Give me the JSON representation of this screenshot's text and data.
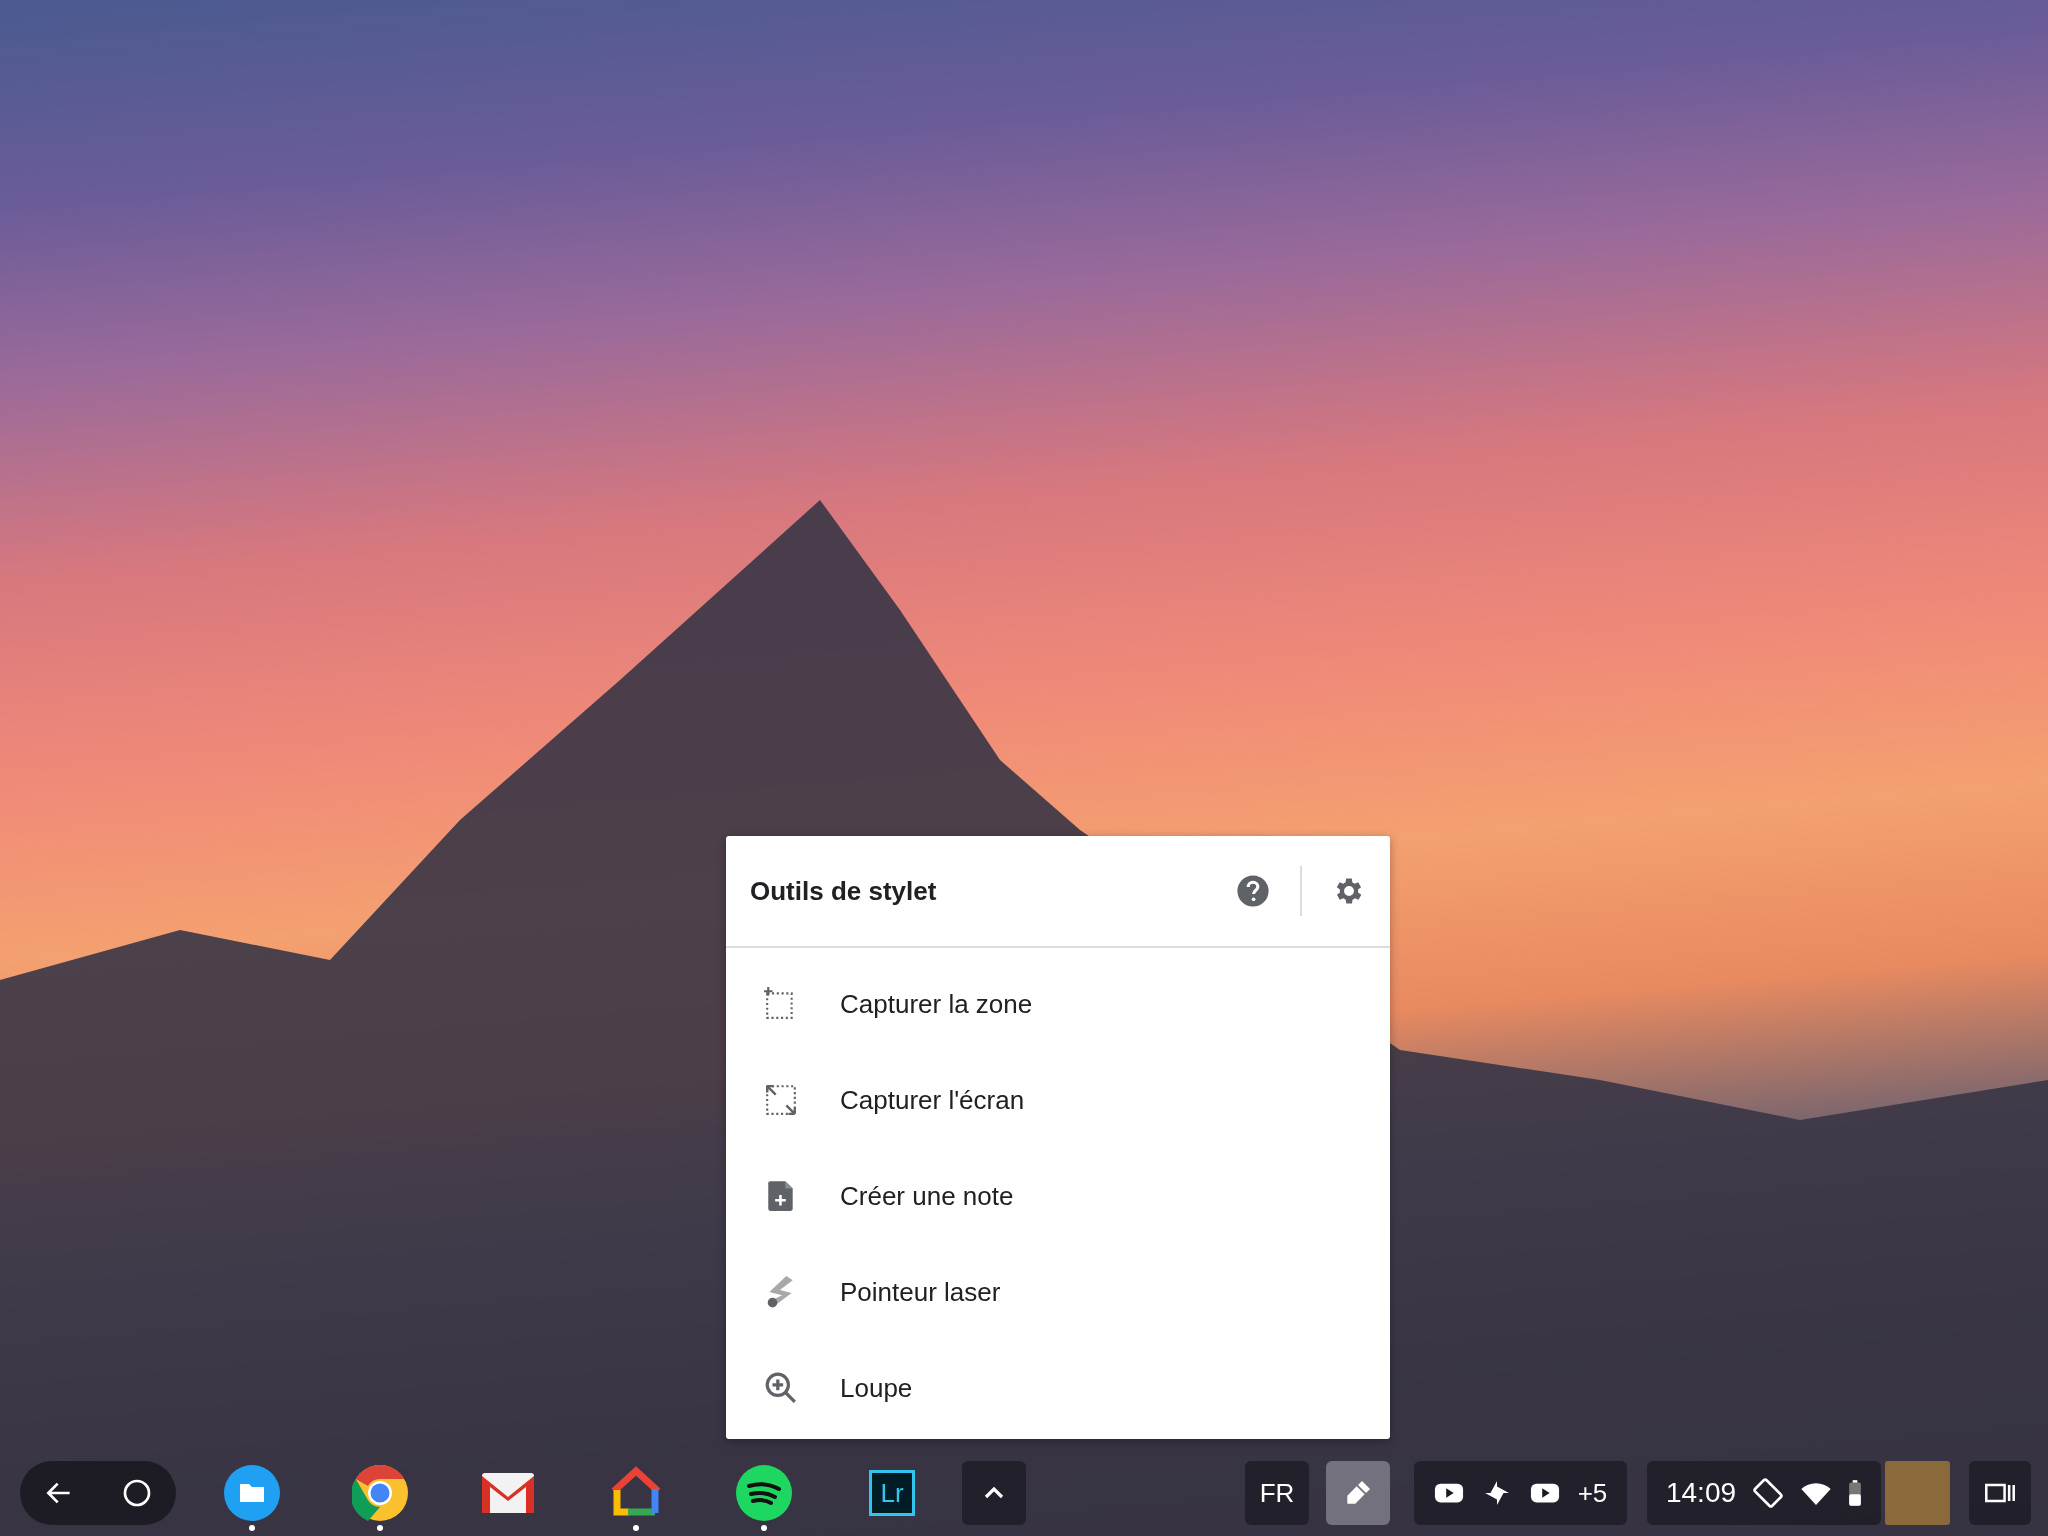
{
  "menu": {
    "title": "Outils de stylet",
    "items": [
      {
        "kind": "region",
        "label": "Capturer la zone"
      },
      {
        "kind": "screen",
        "label": "Capturer l'écran"
      },
      {
        "kind": "note",
        "label": "Créer une note"
      },
      {
        "kind": "laser",
        "label": "Pointeur laser"
      },
      {
        "kind": "magnifier",
        "label": "Loupe"
      }
    ]
  },
  "shelf": {
    "apps": [
      {
        "kind": "files",
        "running": true
      },
      {
        "kind": "chrome",
        "running": true
      },
      {
        "kind": "gmail",
        "running": false
      },
      {
        "kind": "home",
        "running": true
      },
      {
        "kind": "spotify",
        "running": true
      },
      {
        "kind": "lightroom",
        "running": false,
        "label": "Lr"
      }
    ],
    "language": "FR",
    "stylus_button": {
      "active": true
    },
    "notifications": [
      {
        "kind": "youtube"
      },
      {
        "kind": "pinwheel"
      },
      {
        "kind": "youtube"
      }
    ],
    "notification_more": "+5",
    "time": "14:09"
  }
}
